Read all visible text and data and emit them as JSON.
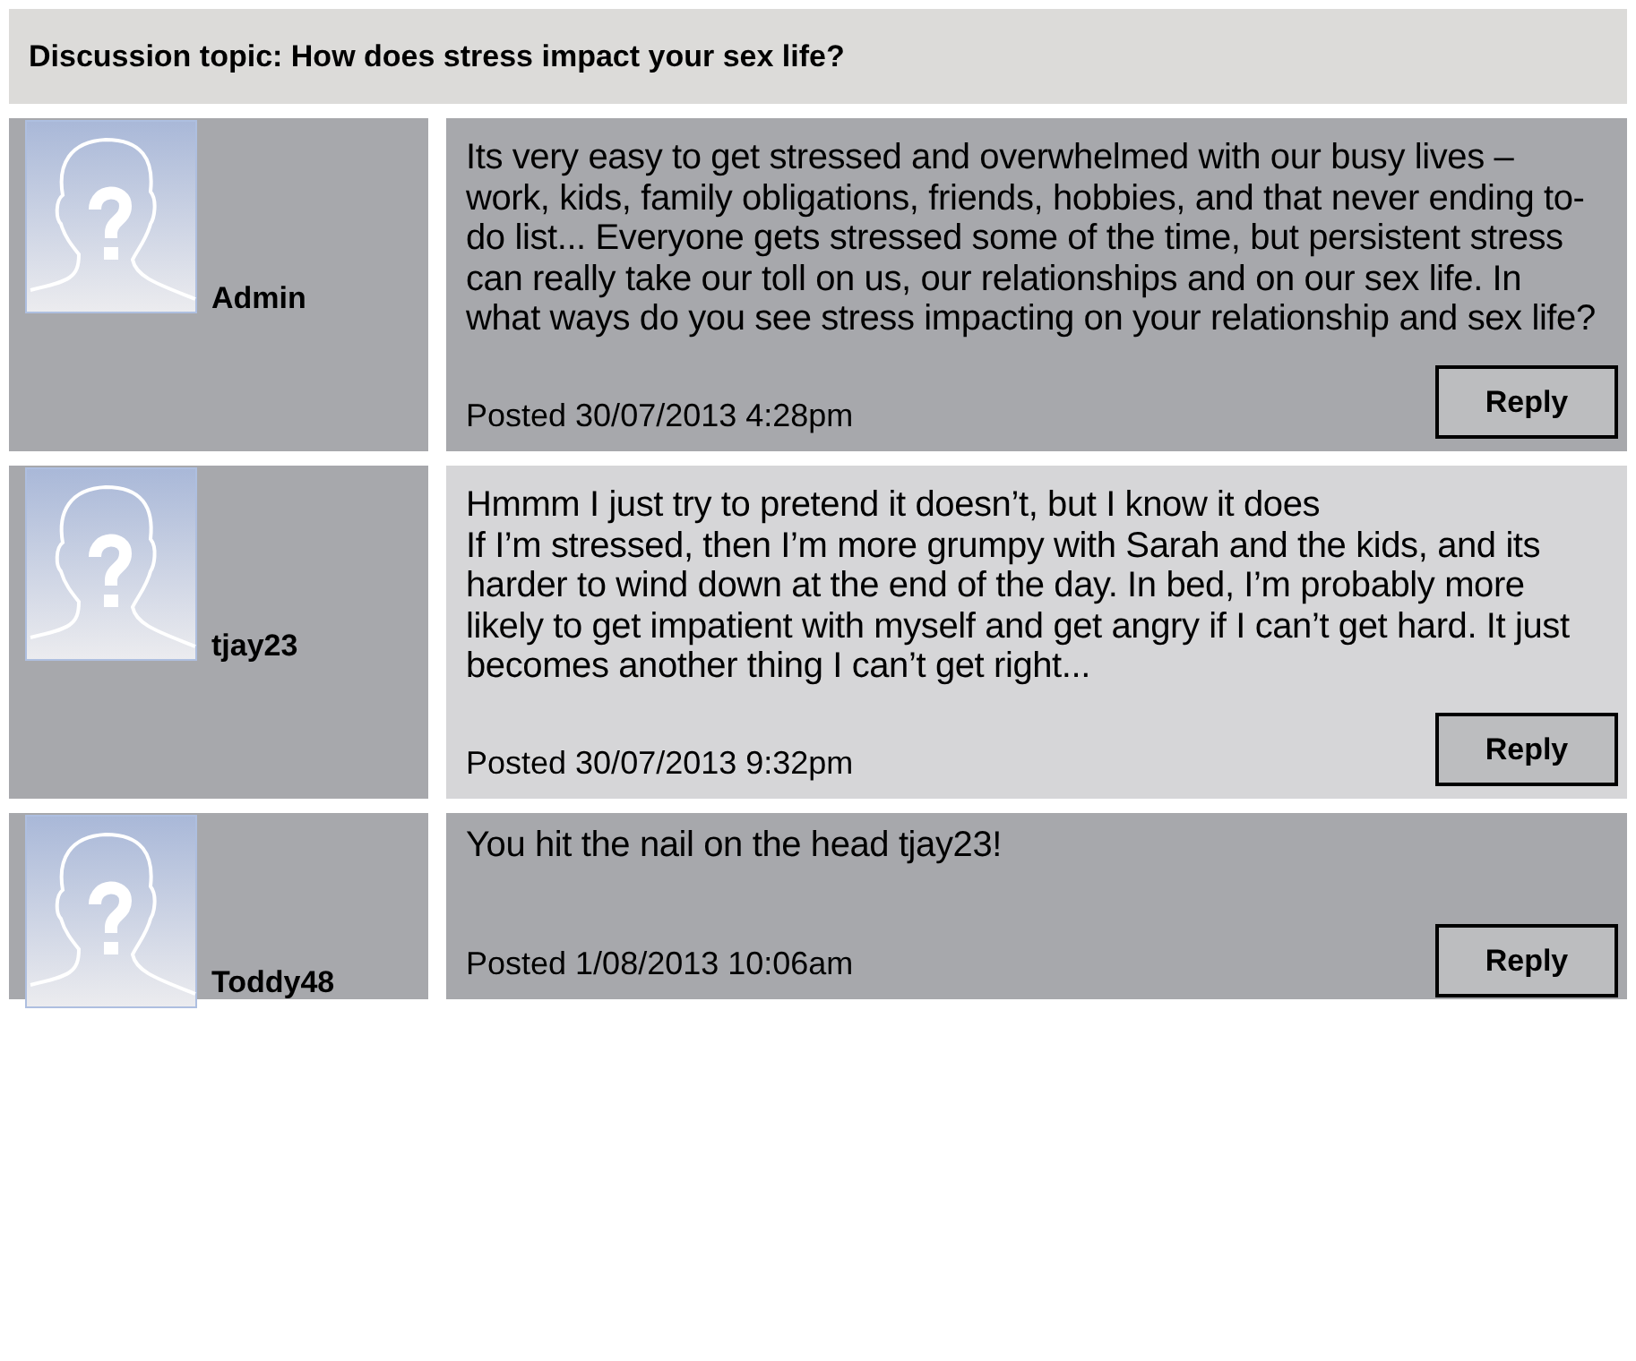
{
  "topic": {
    "title": "Discussion topic: How does stress impact your sex life?"
  },
  "posts": [
    {
      "author": "Admin",
      "body": "Its very easy to get stressed and overwhelmed with our busy lives – work, kids, family obligations, friends, hobbies, and that never ending to-do list... Everyone gets stressed some of the time, but persistent stress can really take our toll on us, our relationships and on our sex life. In what ways do you see stress impacting on your relationship and sex life?",
      "posted": "Posted 30/07/2013 4:28pm",
      "reply": "Reply",
      "highlighted": false,
      "kind": "full"
    },
    {
      "author": "tjay23",
      "body": "Hmmm I just try to pretend it doesn’t, but I know it does\nIf I’m stressed, then I’m more grumpy with Sarah and the kids, and its harder to wind down at the end of the day. In bed, I’m probably more likely to get impatient with myself and get angry if I can’t get hard. It just becomes another thing I can’t get right...",
      "posted": "Posted 30/07/2013 9:32pm",
      "reply": "Reply",
      "highlighted": true,
      "kind": "full"
    },
    {
      "author": "Toddy48",
      "body": "You hit the nail on the head tjay23!",
      "posted": "Posted 1/08/2013 10:06am",
      "reply": "Reply",
      "highlighted": false,
      "kind": "compact"
    }
  ]
}
